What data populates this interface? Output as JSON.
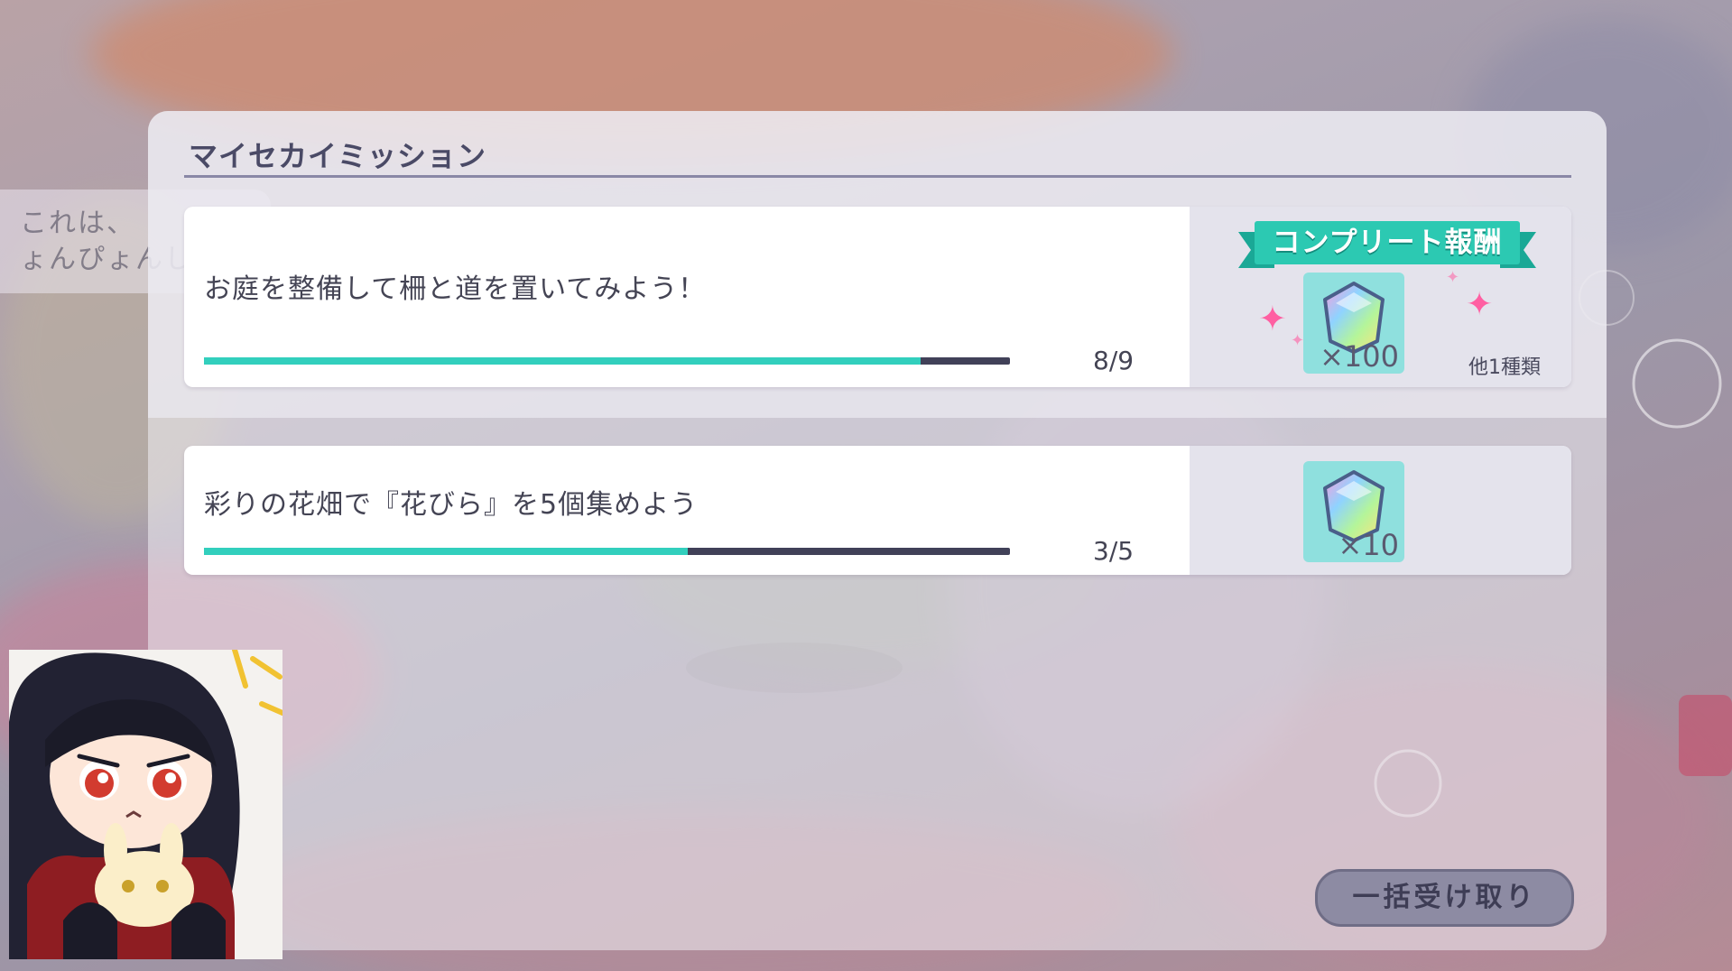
{
  "background": {
    "speech_bubble_text": "これは、\nょんぴょんし",
    "colors": {
      "teal": "#32cfbd",
      "dark": "#414158",
      "ribbon": "#2cc9b2"
    }
  },
  "panel": {
    "title": "マイセカイミッション"
  },
  "missions": [
    {
      "text": "お庭を整備して柵と道を置いてみよう！",
      "progress_label": "8/9",
      "progress_fraction": 0.889,
      "complete_reward_label": "コンプリート報酬",
      "reward_icon": "crystal-icon",
      "reward_qty": "×100",
      "other_rewards": "他1種類"
    },
    {
      "text": "彩りの花畑で『花びら』を5個集めよう",
      "progress_label": "3/5",
      "progress_fraction": 0.6,
      "reward_icon": "crystal-icon",
      "reward_qty": "×10"
    }
  ],
  "buttons": {
    "bulk_receive": "一括受け取り"
  },
  "overlay": {
    "avatar_icon": "chibi-character-avatar"
  }
}
